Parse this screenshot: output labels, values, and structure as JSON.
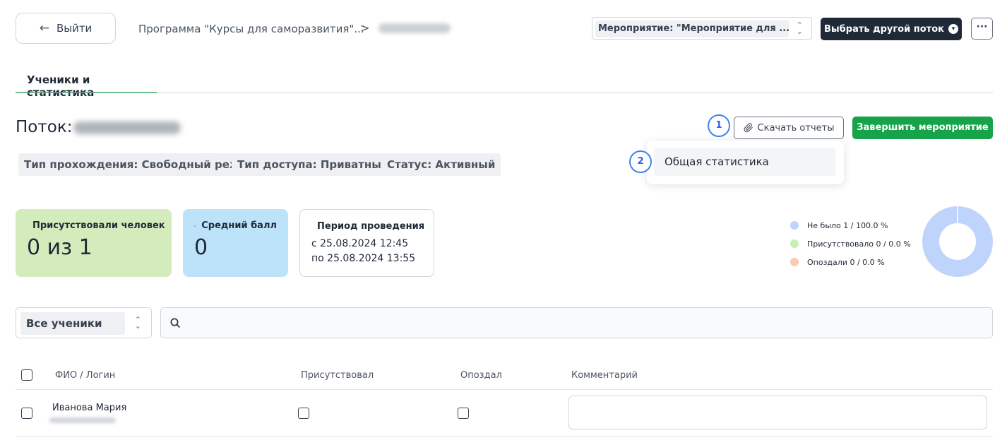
{
  "header": {
    "back_label": "Выйти",
    "breadcrumb_program": "Программа \"Курсы для саморазвития\"...",
    "breadcrumb_separator": ">",
    "event_select_value": "Мероприятие: \"Мероприятие для ...",
    "choose_stream_label": "Выбрать другой поток",
    "more_label": "···"
  },
  "tabs": [
    {
      "label": "Ученики и статистика",
      "active": true
    }
  ],
  "stream": {
    "title_prefix": "Поток:",
    "chips": [
      "Тип прохождения: Свободный реж...",
      "Тип доступа: Приватный",
      "Статус: Активный"
    ]
  },
  "actions": {
    "badge_1": "1",
    "download_label": "Скачать отчеты",
    "finish_label": "Завершить мероприятие",
    "badge_2": "2",
    "dropdown_item": "Общая статистика"
  },
  "stats": {
    "attendance": {
      "label": "Присутствовали человек",
      "value": "0 из 1"
    },
    "score": {
      "label": "Средний балл",
      "value": "0"
    },
    "period": {
      "label": "Период проведения",
      "from": "с 25.08.2024 12:45",
      "to": "по 25.08.2024 13:55"
    }
  },
  "chart_data": {
    "type": "pie",
    "series": [
      {
        "name": "Не было 1 / 100.0 %",
        "value": 1,
        "color": "#bfd4fb"
      },
      {
        "name": "Присутствовало 0 / 0.0 %",
        "value": 0,
        "color": "#c6f0b6"
      },
      {
        "name": "Опоздали 0 / 0.0 %",
        "value": 0,
        "color": "#fcc9b4"
      }
    ]
  },
  "filters": {
    "students_select": "Все ученики",
    "search_placeholder": ""
  },
  "table": {
    "headers": [
      "ФИО / Логин",
      "Присутствовал",
      "Опоздал",
      "Комментарий"
    ],
    "rows": [
      {
        "name": "Иванова Мария",
        "present": false,
        "late": false,
        "comment": ""
      }
    ]
  },
  "colors": {
    "accent_green": "#16a34a",
    "dark": "#1f2937",
    "badge_blue": "#3b82f6"
  }
}
